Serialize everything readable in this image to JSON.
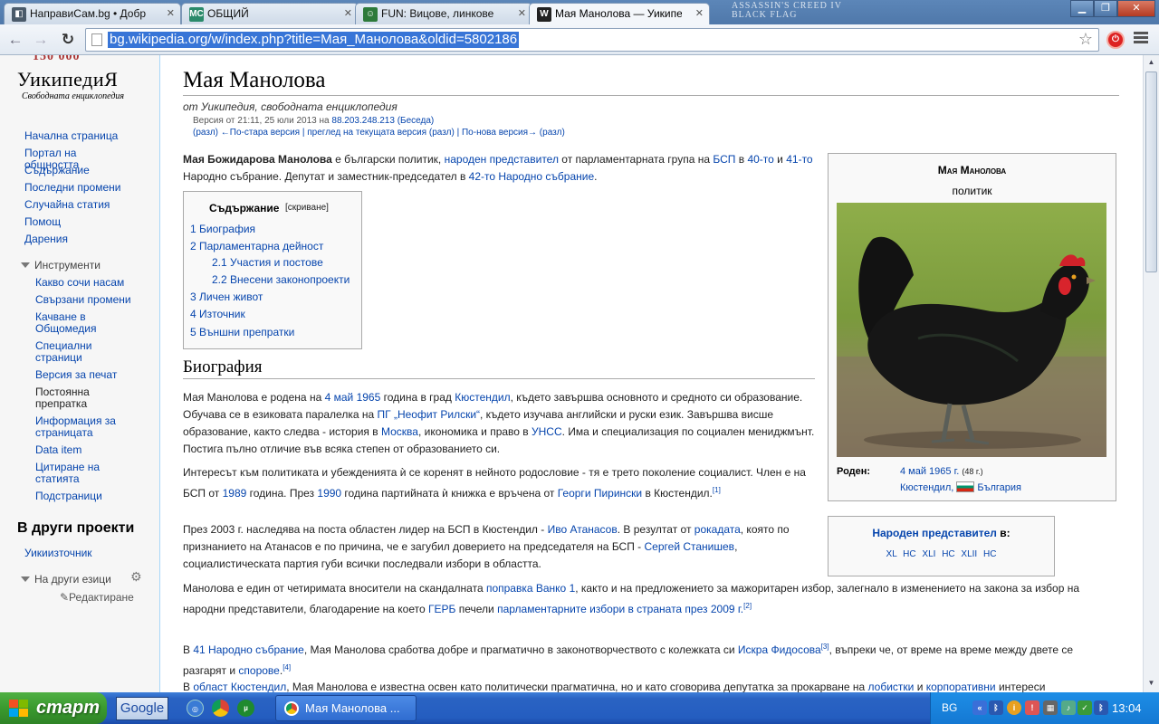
{
  "browser": {
    "tabs": [
      {
        "label": "НаправиСам.bg • Добр",
        "icon": "naprvisam-favicon",
        "color": "#4a5a6a"
      },
      {
        "label": "ОБЩИЙ",
        "icon": "mc-favicon",
        "icon_text": "MC",
        "color": "#2a8a6a"
      },
      {
        "label": "FUN: Вицове, линкове",
        "icon": "fun-favicon",
        "color": "#2d7a3a"
      },
      {
        "label": "Мая Манолова — Уикипедия",
        "icon": "wikipedia-favicon",
        "icon_text": "W",
        "color": "#222"
      }
    ],
    "decor_text": "ASSASSIN'S CREED IV BLACK FLAG",
    "url": "bg.wikipedia.org/w/index.php?title=Мая_Манолова&oldid=5802186",
    "stop_ext_label": "⏻"
  },
  "sidebar": {
    "logo_top": "150 000",
    "logo_word": "УикипедиЯ",
    "logo_tagline": "Свободната енциклопедия",
    "nav": [
      "Начална страница",
      "Портал на общността",
      "Съдържание",
      "Последни промени",
      "Случайна статия",
      "Помощ",
      "Дарения"
    ],
    "tools_heading": "Инструменти",
    "tools": [
      "Какво сочи насам",
      "Свързани промени",
      "Качване в Общомедия",
      "Специални страници",
      "Версия за печат",
      "Постоянна препратка",
      "Информация за страницата",
      "Data item",
      "Цитиране на статията",
      "Подстраници"
    ],
    "other_projects_heading": "В други проекти",
    "other_projects": [
      "Уикиизточник"
    ],
    "languages_heading": "На други езици",
    "edit_link": "✎Редактиране"
  },
  "article": {
    "title": "Мая Манолова",
    "tagline": "от Уикипедия, свободната енциклопедия",
    "rev_line1": "Версия от 21:11, 25 юли 2013 на ",
    "rev_ip": "88.203.248.213",
    "rev_talk": "(Беседа)",
    "rev_line2": "(разл) ←По-стара версия | преглед на текущата версия (разл) | По-нова версия→ (разл)",
    "lead": [
      {
        "t": "Мая Божидарова Манолова",
        "b": true
      },
      {
        "t": " е български политик, "
      },
      {
        "t": "народен представител",
        "l": true
      },
      {
        "t": " от парламентарната група на "
      },
      {
        "t": "БСП",
        "l": true
      },
      {
        "t": " в "
      },
      {
        "t": "40-то",
        "l": true
      },
      {
        "t": " и "
      },
      {
        "t": "41-то",
        "l": true
      },
      {
        "t": " Народно събрание. Депутат и заместник-председател в "
      },
      {
        "t": "42-то Народно събрание",
        "l": true
      },
      {
        "t": "."
      }
    ],
    "toc": {
      "title": "Съдържание",
      "hide": "[скриване]",
      "items": [
        "1 Биография",
        "2 Парламентарна дейност",
        "2.1 Участия и постове",
        "2.2 Внесени законопроекти",
        "3 Личен живот",
        "4 Източник",
        "5 Външни препратки"
      ]
    },
    "section_bio": "Биография",
    "p1": [
      {
        "t": "Мая Манолова е родена на "
      },
      {
        "t": "4 май",
        "l": true
      },
      {
        "t": " "
      },
      {
        "t": "1965",
        "l": true
      },
      {
        "t": " година в град "
      },
      {
        "t": "Кюстендил",
        "l": true
      },
      {
        "t": ", където завършва основното и средното си образование. Обучава се в езиковата паралелка на "
      },
      {
        "t": "ПГ „Неофит Рилски“",
        "l": true
      },
      {
        "t": ", където изучава английски и руски език. Завършва висше образование, както следва - история в "
      },
      {
        "t": "Москва",
        "l": true
      },
      {
        "t": ", икономика и право в "
      },
      {
        "t": "УНСС",
        "l": true
      },
      {
        "t": ". Има и специализация по социален мениджмънт. Постига пълно отличие във всяка степен от образованието си."
      }
    ],
    "p2": [
      {
        "t": "Интересът към политиката и убежденията ѝ се коренят в нейното родословие - тя е трето поколение социалист. Член е на БСП от "
      },
      {
        "t": "1989",
        "l": true
      },
      {
        "t": " година. През "
      },
      {
        "t": "1990",
        "l": true
      },
      {
        "t": " година партийната ѝ книжка е връчена от "
      },
      {
        "t": "Георги Пирински",
        "l": true
      },
      {
        "t": " в Кюстендил."
      },
      {
        "t": "[1]",
        "sup": true
      }
    ],
    "p3": [
      {
        "t": "През 2003 г. наследява на поста областен лидер на БСП в Кюстендил - "
      },
      {
        "t": "Иво Атанасов",
        "l": true
      },
      {
        "t": ". В резултат от "
      },
      {
        "t": "рокадата",
        "l": true
      },
      {
        "t": ", която по признанието на Атанасов е по причина, че е загубил доверието на председателя на БСП - "
      },
      {
        "t": "Сергей Станишев",
        "l": true
      },
      {
        "t": ", социалистическата партия губи всички последвали избори в областта."
      }
    ],
    "p4": [
      {
        "t": "Манолова е един от четиримата вносители на скандалната "
      },
      {
        "t": "поправка Ванко 1",
        "l": true
      },
      {
        "t": ", както и на предложението за мажоритарен избор, залегнало в изменението на закона за избор на народни представители, благодарение на което "
      },
      {
        "t": "ГЕРБ",
        "l": true
      },
      {
        "t": " печели "
      },
      {
        "t": "парламентарните избори в страната през 2009 г.",
        "l": true
      },
      {
        "t": "[2]",
        "sup": true
      }
    ],
    "p5": [
      {
        "t": "В "
      },
      {
        "t": "41 Народно събрание",
        "l": true
      },
      {
        "t": ", Мая Манолова сработва добре и прагматично в законотворчеството с колежката си "
      },
      {
        "t": "Искра Фидосова",
        "l": true
      },
      {
        "t": "[3]",
        "sup": true
      },
      {
        "t": ", въпреки че, от време на време между двете се разгарят и "
      },
      {
        "t": "спорове",
        "l": true
      },
      {
        "t": "."
      },
      {
        "t": "[4]",
        "sup": true
      }
    ],
    "p6": [
      {
        "t": "В "
      },
      {
        "t": "област Кюстендил",
        "l": true
      },
      {
        "t": ", Мая Манолова е известна освен като политически прагматична, но и като сговорива депутатка за прокарване на "
      },
      {
        "t": "лобистки",
        "l": true
      },
      {
        "t": " и "
      },
      {
        "t": "корпоративни",
        "l": true
      },
      {
        "t": " интереси"
      }
    ]
  },
  "infobox": {
    "name": "Мая Манолова",
    "subtitle": "политик",
    "born_label": "Роден:",
    "born_date": "4 май 1965 г.",
    "born_age": "(48 г.)",
    "born_place": "Кюстендил",
    "born_country": "България"
  },
  "navbox": {
    "title_link": "Народен представител",
    "title_rest": " в:",
    "links": "XL НС   XLI НС   XLII НС"
  },
  "taskbar": {
    "start_label": "старт",
    "google_label": "Google",
    "task_label": "Мая Манолова ...",
    "lang": "BG",
    "clock": "13:04"
  }
}
